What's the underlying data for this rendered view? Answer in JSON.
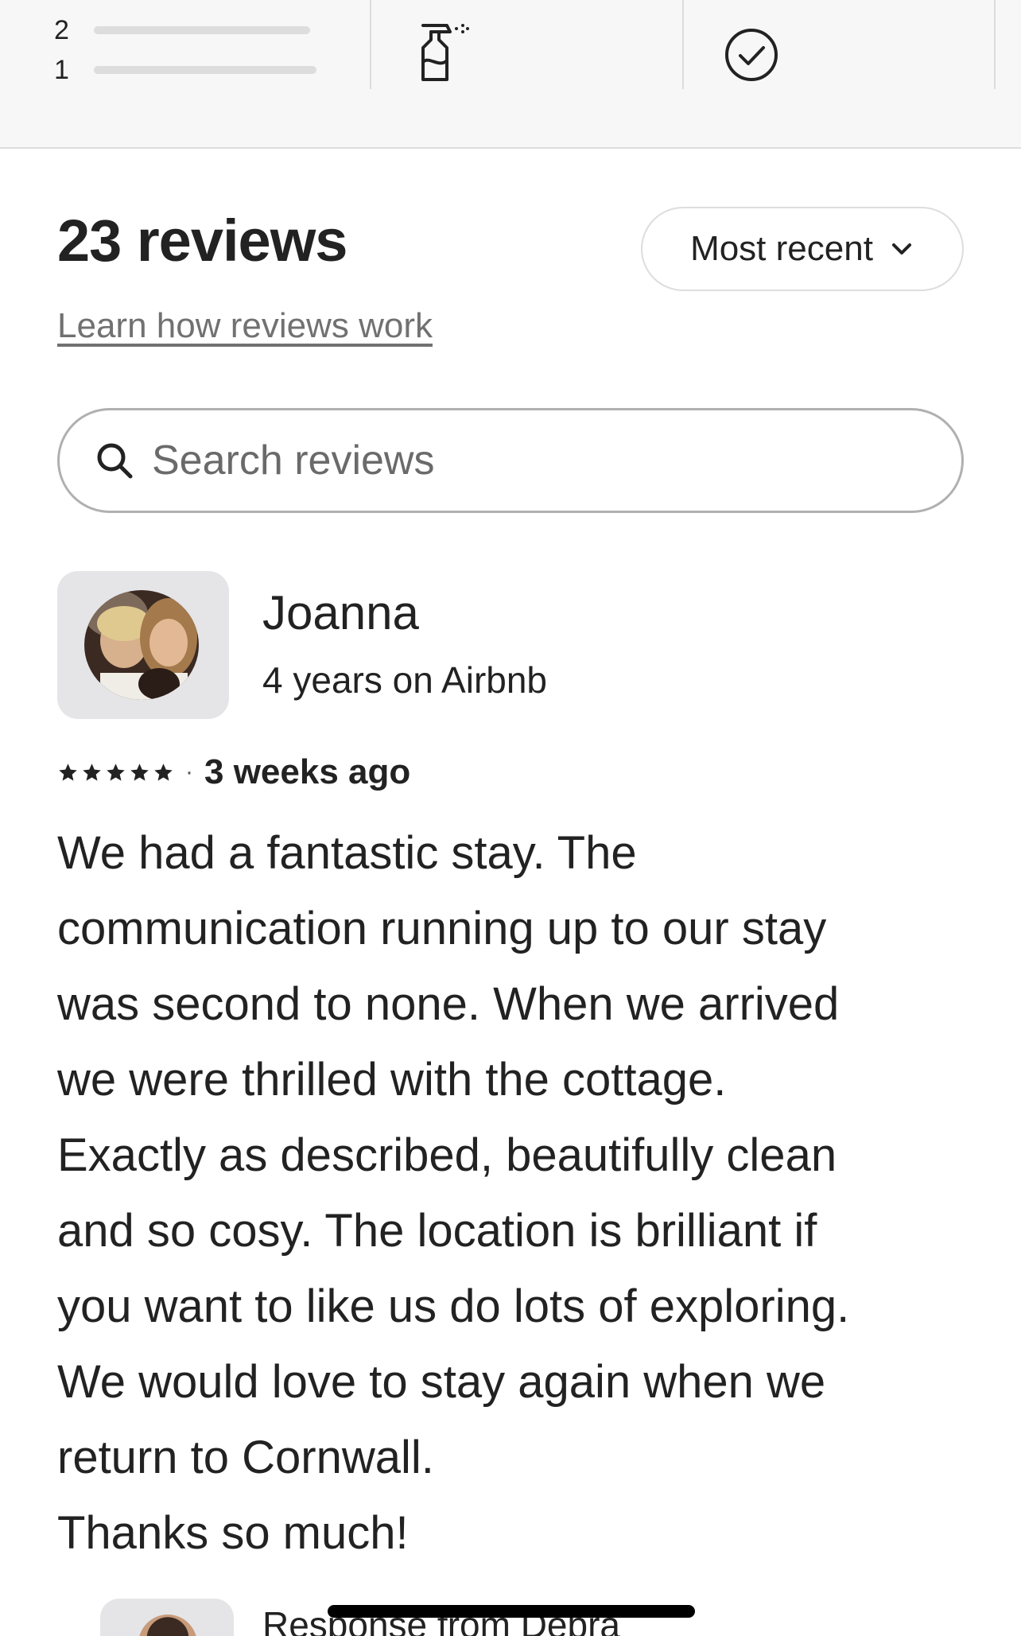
{
  "rating_distribution": {
    "rows": [
      {
        "label": "2"
      },
      {
        "label": "1"
      }
    ]
  },
  "categories": {
    "cleanliness_icon": "spray-bottle-icon",
    "accuracy_icon": "check-circle-icon"
  },
  "reviews_header": {
    "title": "23 reviews",
    "sort_label": "Most recent",
    "learn_link": "Learn how reviews work"
  },
  "search": {
    "placeholder": "Search reviews",
    "value": ""
  },
  "review": {
    "name": "Joanna",
    "tenure": "4 years on Airbnb",
    "rating": 5,
    "stars": "★★★★★",
    "separator": "·",
    "date": "3 weeks ago",
    "body_lines": [
      "We had a fantastic stay. The",
      "communication running up to our stay",
      "was second to none. When we arrived",
      "we were thrilled with the cottage.",
      "Exactly as described, beautifully clean",
      "and so cosy. The location is brilliant if",
      "you want to like us do lots of exploring.",
      "We would love to stay again when we",
      "return to Cornwall.",
      "Thanks so much!"
    ]
  },
  "response": {
    "title": "Response from Debra"
  },
  "colors": {
    "text": "#222222",
    "muted": "#717171",
    "border": "#dddddd",
    "strip_bg": "#f7f7f7"
  }
}
